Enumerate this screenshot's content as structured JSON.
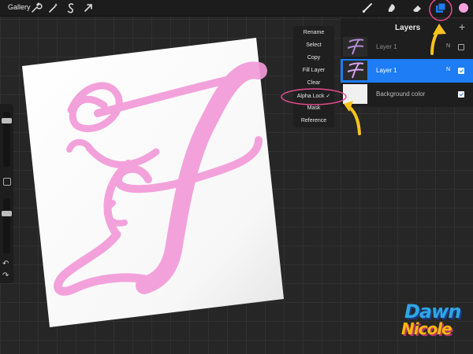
{
  "topbar": {
    "gallery": "Gallery"
  },
  "menu": {
    "items": [
      "Rename",
      "Select",
      "Copy",
      "Fill Layer",
      "Clear",
      "Alpha Lock ✓",
      "Mask",
      "Reference"
    ]
  },
  "layers": {
    "title": "Layers",
    "add": "+",
    "rows": [
      {
        "name": "Layer 1",
        "mode": "N"
      },
      {
        "name": "Layer 1",
        "mode": "N"
      },
      {
        "name": "Background color"
      }
    ]
  },
  "sidebar": {
    "undo": "↶",
    "redo": "↷"
  },
  "logo": {
    "line1": "Dawn",
    "line2": "Nicole"
  },
  "colors": {
    "accent": "#1e7cf5",
    "active_color": "#f7a1e1",
    "highlight_ring": "#e64b8e",
    "arrow": "#f7c31c",
    "lettering": "#f39ad9"
  }
}
